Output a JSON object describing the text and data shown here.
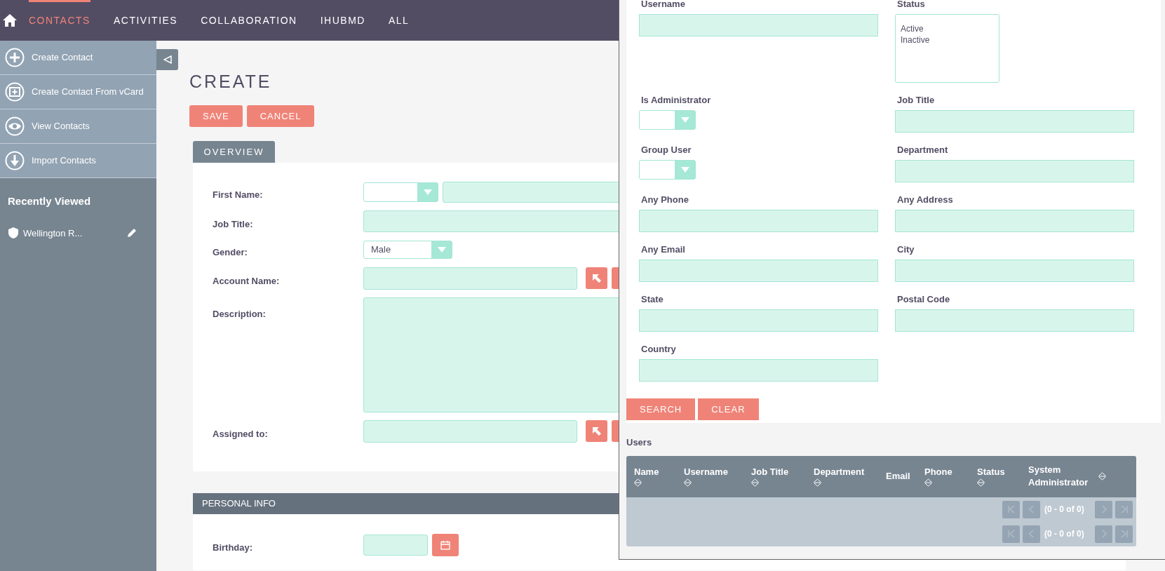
{
  "nav": {
    "items": [
      {
        "label": "CONTACTS",
        "selected": true
      },
      {
        "label": "ACTIVITIES",
        "selected": false
      },
      {
        "label": "COLLABORATION",
        "selected": false
      },
      {
        "label": "IHUBMD",
        "selected": false
      },
      {
        "label": "ALL",
        "selected": false
      }
    ]
  },
  "sidebar": {
    "actions": [
      {
        "label": "Create Contact"
      },
      {
        "label": "Create Contact From vCard"
      },
      {
        "label": "View Contacts"
      },
      {
        "label": "Import Contacts"
      }
    ],
    "recently_viewed": {
      "title": "Recently Viewed",
      "items": [
        {
          "label": "Wellington R..."
        }
      ]
    }
  },
  "main": {
    "title": "CREATE",
    "buttons": [
      "SAVE",
      "CANCEL"
    ],
    "tab": {
      "label": "OVERVIEW"
    },
    "fields": [
      {
        "label": "First Name:",
        "kind": "salutation"
      },
      {
        "label": "Job Title:",
        "kind": "text"
      },
      {
        "label": "Gender:",
        "kind": "select",
        "value": "Male"
      },
      {
        "label": "Account Name:",
        "kind": "relate"
      },
      {
        "label": "Description:",
        "kind": "textarea"
      },
      {
        "label": "Assigned to:",
        "kind": "relate"
      }
    ],
    "personal_info": {
      "title": "PERSONAL INFO",
      "fields": [
        {
          "label": "Birthday:",
          "kind": "date"
        }
      ]
    }
  },
  "popup": {
    "rows": [
      [
        {
          "label": "Username",
          "kind": "text"
        },
        {
          "label": "Status",
          "kind": "listbox",
          "options": [
            "Active",
            "Inactive"
          ]
        }
      ],
      [
        {
          "label": "Is Administrator",
          "kind": "select"
        },
        {
          "label": "Job Title",
          "kind": "text"
        }
      ],
      [
        {
          "label": "Group User",
          "kind": "select"
        },
        {
          "label": "Department",
          "kind": "text"
        }
      ],
      [
        {
          "label": "Any Phone",
          "kind": "text"
        },
        {
          "label": "Any Address",
          "kind": "text"
        }
      ],
      [
        {
          "label": "Any Email",
          "kind": "text"
        },
        {
          "label": "City",
          "kind": "text"
        }
      ],
      [
        {
          "label": "State",
          "kind": "text"
        },
        {
          "label": "Postal Code",
          "kind": "text"
        }
      ],
      [
        {
          "label": "Country",
          "kind": "text"
        }
      ]
    ],
    "buttons": [
      "SEARCH",
      "CLEAR"
    ],
    "users": {
      "title": "Users",
      "columns": [
        {
          "label": "Name",
          "sortable": true
        },
        {
          "label": "Username",
          "sortable": true
        },
        {
          "label": "Job Title",
          "sortable": true
        },
        {
          "label": "Department",
          "sortable": true
        },
        {
          "label": "Email",
          "sortable": false
        },
        {
          "label": "Phone",
          "sortable": true
        },
        {
          "label": "Status",
          "sortable": true
        },
        {
          "label": "System Administrator",
          "sortable": true
        }
      ],
      "pagination": [
        "(0 - 0 of 0)",
        "(0 - 0 of 0)"
      ]
    }
  }
}
